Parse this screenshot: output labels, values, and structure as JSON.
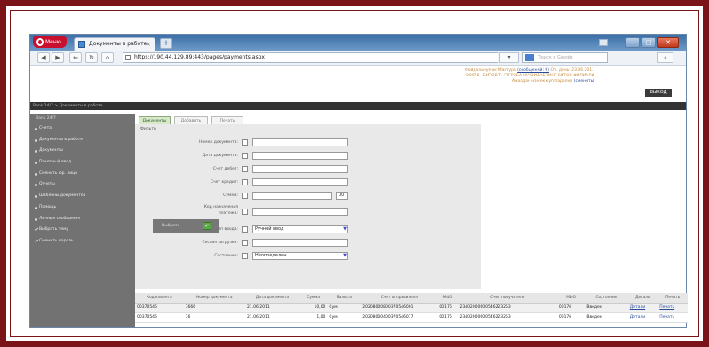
{
  "browser": {
    "menu_label": "Меню",
    "tab_title": "Документы в работе",
    "tab_close": "×",
    "new_tab": "+",
    "url": "https://190.44.129.89:443/pages/payments.aspx",
    "search_placeholder": "Поиск в Google",
    "ctrl_min": "–",
    "ctrl_max": "□",
    "ctrl_close": "✕",
    "back": "◀",
    "forward": "▶",
    "reload": "↻",
    "home": "⌂"
  },
  "user": {
    "line1_prefix": "Фойдаланувчи: Мастура",
    "messages_link": "(сообщений: 0)",
    "line1_suffix": "Оп. день: 23.06.2011",
    "line2": "00978 - БИТОВ Т. \"ЯГРОБАНК\" ОИЛАБЛИНГ БИТОВ ФИЛИАЛИ",
    "line3_prefix": "Амалдан нэжек куп паролно",
    "change_link": "(сменить)",
    "logout": "ВЫХОД"
  },
  "breadcrumb": "Bank 24/7 > Документы в работе",
  "sidebar": {
    "title": "Bank 24/7",
    "items": [
      {
        "label": "Счета",
        "type": "dot"
      },
      {
        "label": "Документы в работе",
        "type": "dot"
      },
      {
        "label": "Документы",
        "type": "dot"
      },
      {
        "label": "Пакетный ввод",
        "type": "dot"
      },
      {
        "label": "Сменить юр. лицо",
        "type": "dot"
      },
      {
        "label": "Отчеты",
        "type": "dot"
      },
      {
        "label": "Шаблоны документов",
        "type": "dot"
      },
      {
        "label": "Помощь",
        "type": "dot"
      },
      {
        "label": "Личные сообщения",
        "type": "dot"
      },
      {
        "label": "Выбрать тему",
        "type": "check"
      },
      {
        "label": "Сменить пароль",
        "type": "check"
      }
    ]
  },
  "tabs": {
    "documents": "Документы",
    "add": "Добавить",
    "print": "Печать"
  },
  "filter": {
    "title": "Фильтр",
    "doc_number": "Номер документа:",
    "doc_date": "Дата документа:",
    "debit_account": "Счет дебет:",
    "credit_account": "Счет кредит:",
    "amount": "Сумма:",
    "amount_cents": "00",
    "purpose_code": "Код назначения",
    "purpose_code2": "платежа:",
    "input_type": "Тип ввода:",
    "input_type_value": "Ручной ввод",
    "load_session": "Сессия загрузки:",
    "status": "Состояние:",
    "status_value": "Неопределен",
    "apply_button": "Выбрать",
    "apply_check": "✓"
  },
  "table": {
    "headers": [
      "Код клиента",
      "Номер документа",
      "Дата документа",
      "Сумма",
      "Валюта",
      "Счет отправителя",
      "МФО",
      "Счет получателя",
      "МФО",
      "Состояние",
      "Детали",
      "Печать"
    ],
    "rows": [
      [
        "00370546",
        "7666",
        "21.06.2011",
        "10,00",
        "Сум",
        "20208000800370546001",
        "00176",
        "23402000600546223253",
        "00176",
        "Введен",
        "Детали",
        "Печать"
      ],
      [
        "00370546",
        "76",
        "21.06.2011",
        "1,00",
        "Сум",
        "20208000400370546077",
        "00176",
        "23402000600546223253",
        "00176",
        "Введен",
        "Детали",
        "Печать"
      ]
    ]
  }
}
